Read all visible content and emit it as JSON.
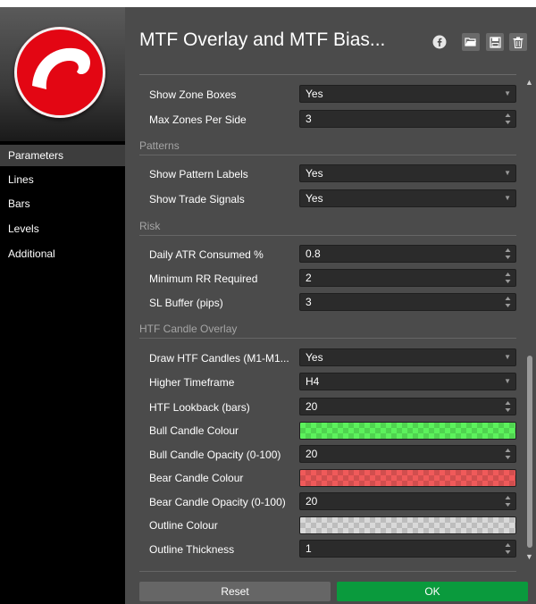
{
  "window_title": "MTF Overlay and MTF Bias...",
  "sidebar": {
    "items": [
      {
        "label": "Parameters",
        "active": true
      },
      {
        "label": "Lines",
        "active": false
      },
      {
        "label": "Bars",
        "active": false
      },
      {
        "label": "Levels",
        "active": false
      },
      {
        "label": "Additional",
        "active": false
      }
    ]
  },
  "header_icons": [
    "facebook-icon",
    "open-folder-icon",
    "save-icon",
    "trash-icon"
  ],
  "sections": {
    "patterns": "Patterns",
    "risk": "Risk",
    "htf": "HTF Candle Overlay"
  },
  "params": {
    "show_zone_boxes": {
      "label": "Show Zone Boxes",
      "value": "Yes"
    },
    "max_zones_per_side": {
      "label": "Max Zones Per Side",
      "value": "3"
    },
    "show_pattern_labels": {
      "label": "Show Pattern Labels",
      "value": "Yes"
    },
    "show_trade_signals": {
      "label": "Show Trade Signals",
      "value": "Yes"
    },
    "daily_atr_consumed": {
      "label": "Daily ATR Consumed %",
      "value": "0.8"
    },
    "minimum_rr_required": {
      "label": "Minimum RR Required",
      "value": "2"
    },
    "sl_buffer": {
      "label": "SL Buffer (pips)",
      "value": "3"
    },
    "draw_htf_candles": {
      "label": "Draw HTF Candles (M1-M1...",
      "value": "Yes"
    },
    "higher_timeframe": {
      "label": "Higher Timeframe",
      "value": "H4"
    },
    "htf_lookback": {
      "label": "HTF Lookback (bars)",
      "value": "20"
    },
    "bull_candle_colour": {
      "label": "Bull Candle Colour",
      "color": "#5cf25c"
    },
    "bull_candle_opacity": {
      "label": "Bull Candle Opacity (0-100)",
      "value": "20"
    },
    "bear_candle_colour": {
      "label": "Bear Candle Colour",
      "color": "#f05a5a"
    },
    "bear_candle_opacity": {
      "label": "Bear Candle Opacity (0-100)",
      "value": "20"
    },
    "outline_colour": {
      "label": "Outline Colour",
      "color": "#d9d9d9"
    },
    "outline_thickness": {
      "label": "Outline Thickness",
      "value": "1"
    }
  },
  "footer": {
    "reset_label": "Reset",
    "ok_label": "OK"
  },
  "colors": {
    "ok_button": "#0a9a3d",
    "reset_button": "#666666",
    "logo_red": "#e30613"
  }
}
